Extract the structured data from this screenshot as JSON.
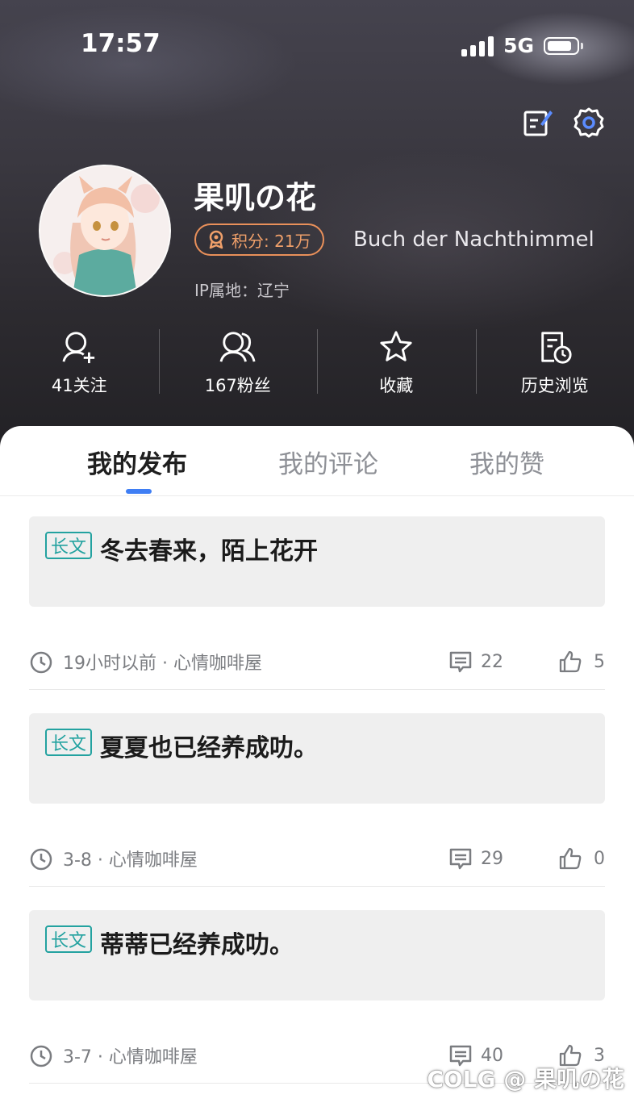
{
  "status_bar": {
    "time": "17:57",
    "network": "5G",
    "battery_level": 0.85
  },
  "profile": {
    "username": "果叽の花",
    "points": "积分: 21万",
    "medal_title": "Buch der Nachthimmel",
    "ip_location": "IP属地：辽宁"
  },
  "stats": [
    {
      "label": "41关注",
      "icon": "follow-icon"
    },
    {
      "label": "167粉丝",
      "icon": "fans-icon"
    },
    {
      "label": "收藏",
      "icon": "star-icon"
    },
    {
      "label": "历史浏览",
      "icon": "history-icon"
    }
  ],
  "tabs": [
    {
      "label": "我的发布",
      "active": true
    },
    {
      "label": "我的评论",
      "active": false
    },
    {
      "label": "我的赞",
      "active": false
    }
  ],
  "posts": [
    {
      "tag": "长文",
      "title": "冬去春来，陌上花开",
      "meta": "19小时以前 · 心情咖啡屋",
      "comments": "22",
      "likes": "5"
    },
    {
      "tag": "长文",
      "title": "夏夏也已经养成叻。",
      "meta": "3-8 · 心情咖啡屋",
      "comments": "29",
      "likes": "0"
    },
    {
      "tag": "长文",
      "title": "蒂蒂已经养成叻。",
      "meta": "3-7 · 心情咖啡屋",
      "comments": "40",
      "likes": "3"
    }
  ],
  "watermark": "COLG @ 果叽の花",
  "colors": {
    "accent": "#3f7ef4",
    "tag": "#23a2a0",
    "points": "#e9905a"
  }
}
